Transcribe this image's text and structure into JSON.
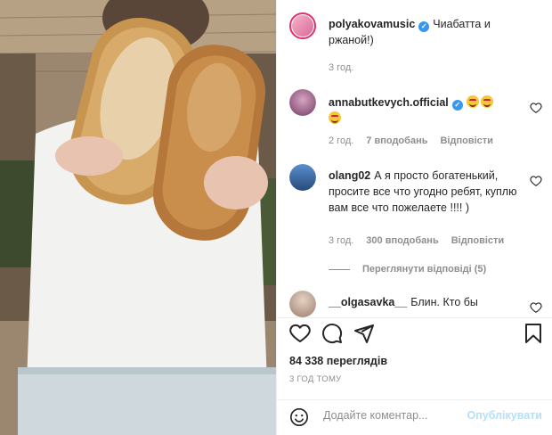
{
  "caption": {
    "username": "polyakovamusic",
    "text": "Чиабатта и ржаной!)",
    "time": "3 год."
  },
  "comments": [
    {
      "username": "annabutkevych.official",
      "emojis": [
        "star-struck-emoji",
        "yum-emoji",
        "grin-emoji"
      ],
      "time": "2 год.",
      "likes": "7 вподобань",
      "reply_label": "Відповісти"
    },
    {
      "username": "olang02",
      "text": "А я просто богатенький, просите все что угодно ребят, куплю вам все что пожелаете !!!! )",
      "time": "3 год.",
      "likes": "300 вподобань",
      "reply_label": "Відповісти",
      "view_replies": "Переглянути відповіді (5)"
    },
    {
      "username": "__olgasavka__",
      "text": "Блин. Кто бы"
    }
  ],
  "actions": {
    "icons": [
      "heart-icon",
      "comment-icon",
      "share-icon",
      "bookmark-icon"
    ]
  },
  "views": "84 338 переглядів",
  "posted": "3 ГОД ТОМУ",
  "composer": {
    "placeholder": "Додайте коментар...",
    "publish_label": "Опублікувати"
  },
  "colors": {
    "accent": "#3897f0",
    "muted": "#8e8e8e",
    "publish_disabled": "#b2dffc"
  }
}
